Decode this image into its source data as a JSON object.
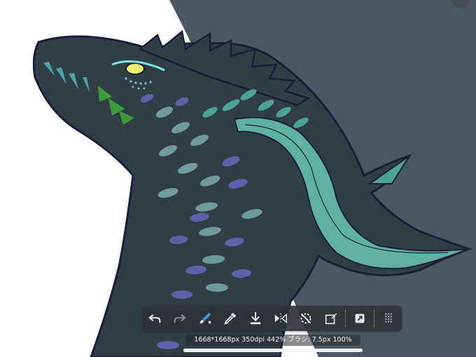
{
  "canvas": {
    "artwork": "dragon-illustration",
    "colors": {
      "background_white": "#ffffff",
      "backdrop_slate": "#4b5861",
      "dragon_body": "#2f3f44",
      "outline": "#1c1d3a",
      "teal_scale": "#4aa394",
      "blue_scale": "#5a63a8",
      "mint_scale": "#7fc6b4",
      "green_tooth": "#3e9a3a",
      "eye_yellow": "#e9f06a"
    }
  },
  "toolbar": {
    "buttons": [
      {
        "name": "undo",
        "icon": "undo-arrow-icon"
      },
      {
        "name": "redo",
        "icon": "redo-arrow-icon"
      },
      {
        "name": "brush-select",
        "icon": "brush-icon"
      },
      {
        "name": "eyedropper",
        "icon": "eyedropper-icon"
      },
      {
        "name": "save",
        "icon": "download-icon"
      },
      {
        "name": "flip-horizontal",
        "icon": "flip-horizontal-icon"
      },
      {
        "name": "rotate-reset",
        "icon": "rotate-slash-icon"
      },
      {
        "name": "edit-layer",
        "icon": "edit-square-icon"
      },
      {
        "name": "export",
        "icon": "export-arrow-icon"
      },
      {
        "name": "grid-menu",
        "icon": "dot-grid-icon"
      }
    ]
  },
  "status": {
    "text": "1668*1668px 350dpi 442% ブラシ: 7.5px 100%"
  }
}
